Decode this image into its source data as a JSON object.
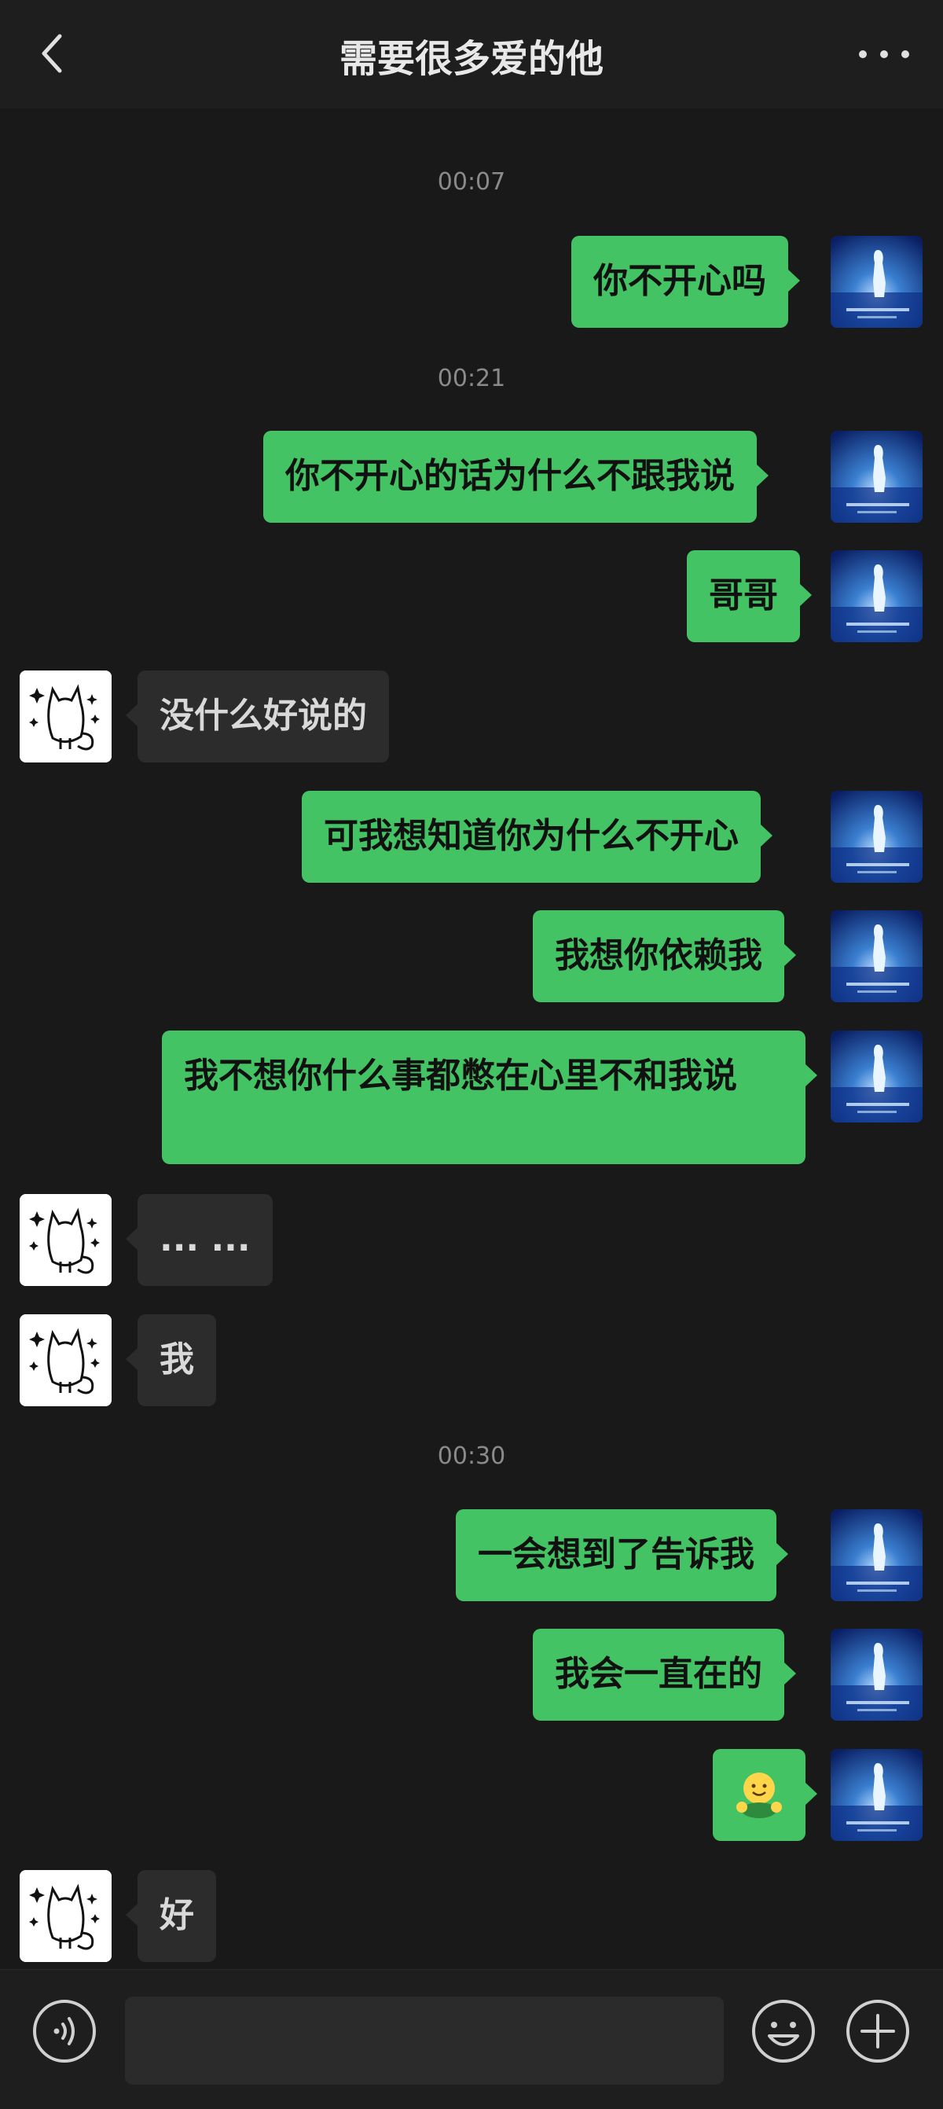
{
  "header": {
    "title": "需要很多爱的他"
  },
  "messages": [
    {
      "time": "00:07"
    },
    {
      "me1": "你不开心吗"
    },
    {
      "time": "00:21"
    }
  ],
  "chat": {
    "t1": "00:07",
    "m1": "你不开心吗",
    "t2": "00:21",
    "m2": "你不开心的话为什么不跟我说",
    "m3": "哥哥",
    "r1": "没什么好说的",
    "m4": "可我想知道你为什么不开心",
    "m5": "我想你依赖我",
    "m6": "我不想你什么事都憋在心里不和我说",
    "r2": "... ...",
    "r3": "我",
    "t3": "00:30",
    "m7": "一会想到了告诉我",
    "m8": "我会一直在的",
    "m9": "🤗",
    "r4": "好"
  },
  "input": {
    "value": ""
  },
  "icons": {
    "back": "chevron-left-icon",
    "more": "more-dots-icon",
    "voice": "voice-icon",
    "emoji": "emoji-icon",
    "plus": "plus-icon"
  },
  "colors": {
    "background": "#191919",
    "my_bubble": "#43c363",
    "their_bubble": "#2c2c2c"
  }
}
